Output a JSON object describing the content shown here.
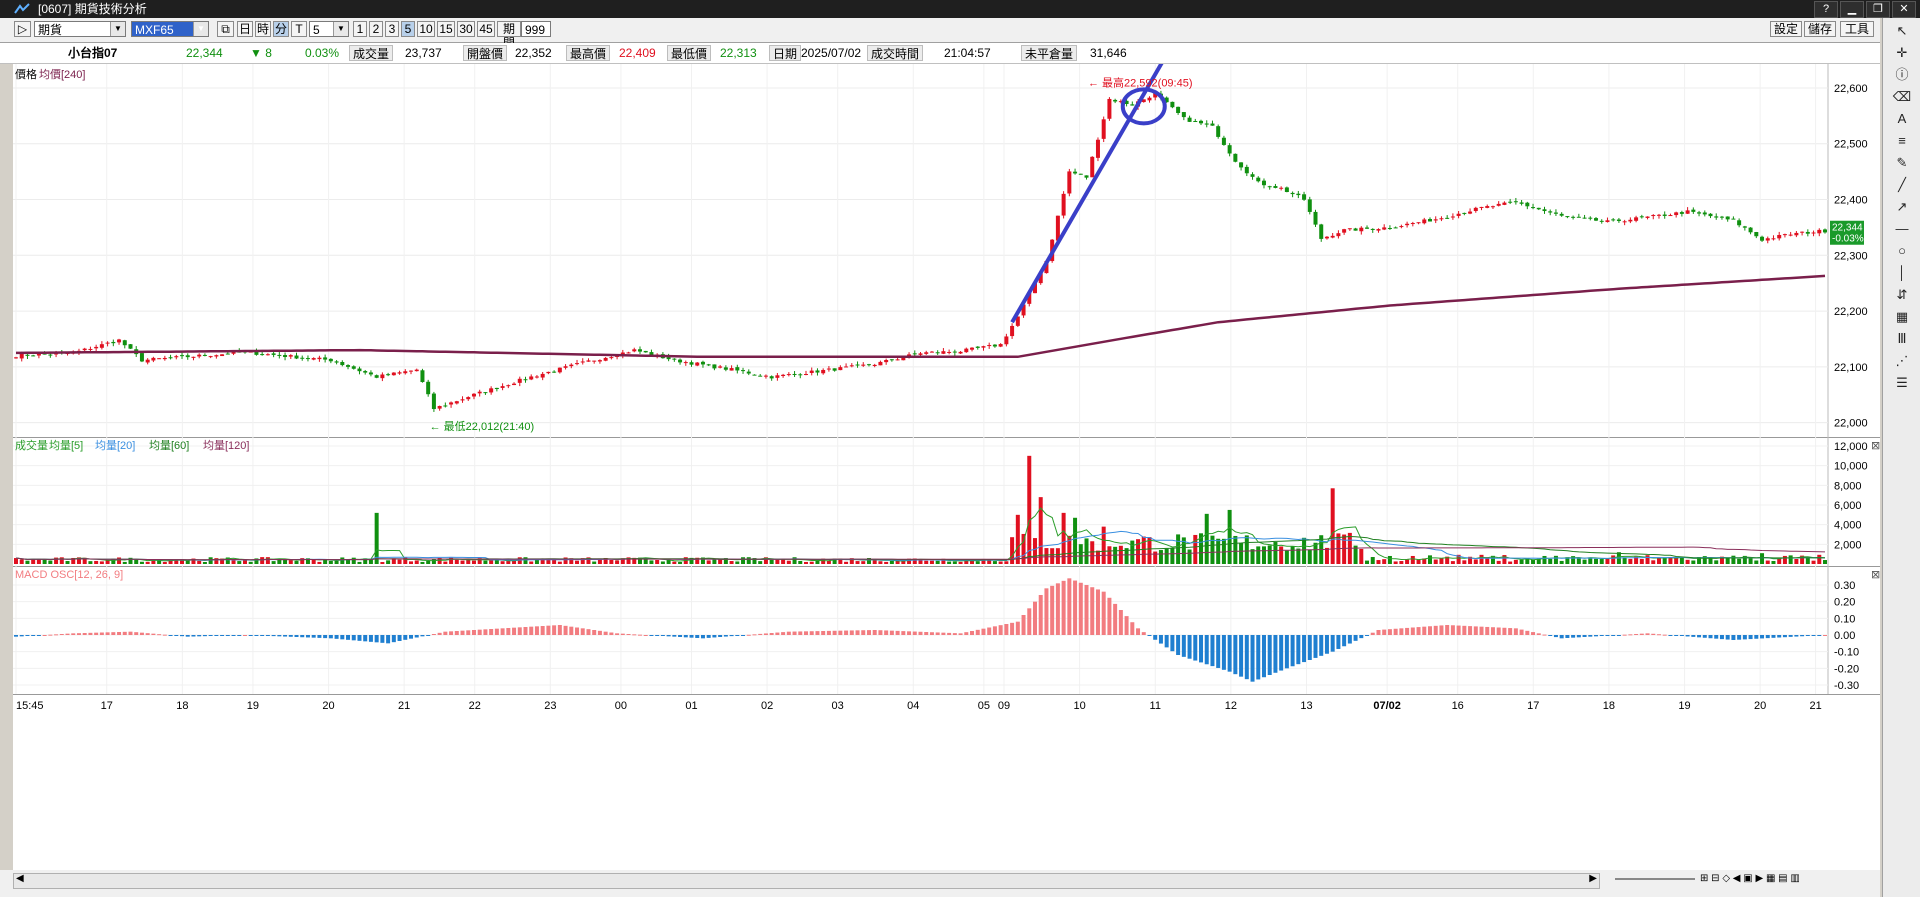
{
  "window": {
    "title": "[0607] 期貨技術分析"
  },
  "toolbar": {
    "market": "期貨",
    "symbol": "MXF65",
    "period_buttons": [
      "日",
      "時",
      "分",
      "T"
    ],
    "interval_value": "5",
    "quick_buttons": [
      "1",
      "2",
      "3",
      "5",
      "10",
      "15",
      "30",
      "45"
    ],
    "range_label": "期間",
    "range_value": "999",
    "right_buttons": [
      "設定",
      "儲存",
      "工具"
    ]
  },
  "quote": {
    "name": "小台指07",
    "last": "22,344",
    "change": "▼ 8",
    "change_pct": "0.03%",
    "volume_label": "成交量",
    "volume": "23,737",
    "open_label": "開盤價",
    "open": "22,352",
    "high_label": "最高價",
    "high": "22,409",
    "low_label": "最低價",
    "low": "22,313",
    "date_label": "日期",
    "date": "2025/07/02",
    "time_label": "成交時間",
    "time": "21:04:57",
    "oi_label": "未平倉量",
    "oi": "31,646"
  },
  "colors": {
    "up": "#e01020",
    "down": "#109010",
    "ma240": "#7a1f4b",
    "macd": "#f27c80",
    "macd_neg": "#1f7fd0",
    "trendline": "#3a3fc8",
    "vol_ma5": "#2a9d2a",
    "vol_ma20": "#3a8fe0",
    "vol_ma60": "#208020",
    "vol_ma120": "#8a2f5b"
  },
  "chart_data": [
    {
      "type": "candlestick",
      "panel": "price",
      "legend": [
        "價格",
        "均價[240]"
      ],
      "y_ticks": [
        "22,600",
        "22,500",
        "22,400",
        "22,300",
        "22,200",
        "22,100",
        "22,000"
      ],
      "ylim": [
        21985,
        22625
      ],
      "x_labels": [
        "15:45",
        "17",
        "18",
        "19",
        "20",
        "21",
        "22",
        "23",
        "00",
        "01",
        "02",
        "03",
        "04",
        "05",
        "09",
        "10",
        "11",
        "12",
        "13",
        "07/02",
        "16",
        "17",
        "18",
        "19",
        "20",
        "21"
      ],
      "annotations": {
        "high": "最高22,592(09:45)",
        "low": "最低22,012(21:40)",
        "last_price": "22,344",
        "last_pct": "-0.03%"
      },
      "keypoints": [
        [
          0,
          22120
        ],
        [
          10,
          22125
        ],
        [
          18,
          22148
        ],
        [
          22,
          22112
        ],
        [
          40,
          22126
        ],
        [
          55,
          22112
        ],
        [
          63,
          22082
        ],
        [
          70,
          22095
        ],
        [
          73,
          22025
        ],
        [
          80,
          22050
        ],
        [
          90,
          22082
        ],
        [
          100,
          22110
        ],
        [
          108,
          22130
        ],
        [
          115,
          22112
        ],
        [
          125,
          22095
        ],
        [
          132,
          22082
        ],
        [
          140,
          22092
        ],
        [
          150,
          22105
        ],
        [
          158,
          22125
        ],
        [
          165,
          22128
        ],
        [
          172,
          22140
        ],
        [
          175,
          22190
        ],
        [
          180,
          22290
        ],
        [
          184,
          22450
        ],
        [
          187,
          22440
        ],
        [
          191,
          22580
        ],
        [
          195,
          22570
        ],
        [
          199,
          22590
        ],
        [
          204,
          22545
        ],
        [
          209,
          22530
        ],
        [
          213,
          22470
        ],
        [
          217,
          22430
        ],
        [
          221,
          22420
        ],
        [
          225,
          22400
        ],
        [
          228,
          22330
        ],
        [
          232,
          22345
        ],
        [
          240,
          22350
        ],
        [
          248,
          22365
        ],
        [
          256,
          22385
        ],
        [
          262,
          22395
        ],
        [
          270,
          22370
        ],
        [
          278,
          22360
        ],
        [
          285,
          22368
        ],
        [
          292,
          22378
        ],
        [
          300,
          22362
        ],
        [
          305,
          22328
        ],
        [
          310,
          22338
        ],
        [
          316,
          22344
        ]
      ],
      "ma240_points": [
        [
          0,
          22125
        ],
        [
          60,
          22130
        ],
        [
          120,
          22118
        ],
        [
          175,
          22118
        ],
        [
          190,
          22145
        ],
        [
          210,
          22180
        ],
        [
          240,
          22210
        ],
        [
          280,
          22240
        ],
        [
          316,
          22263
        ]
      ]
    },
    {
      "type": "bar",
      "panel": "volume",
      "legend": [
        "成交量",
        "均量[5]",
        "均量[20]",
        "均量[60]",
        "均量[120]"
      ],
      "y_ticks": [
        "12,000",
        "10,000",
        "8,000",
        "6,000",
        "4,000",
        "2,000"
      ],
      "ylim": [
        0,
        12000
      ],
      "peaks": [
        [
          63,
          5200
        ],
        [
          175,
          5000
        ],
        [
          177,
          11000
        ],
        [
          179,
          6800
        ],
        [
          183,
          5200
        ],
        [
          185,
          4700
        ],
        [
          190,
          3800
        ],
        [
          208,
          5100
        ],
        [
          212,
          5500
        ],
        [
          230,
          7700
        ],
        [
          280,
          1200
        ],
        [
          305,
          1100
        ]
      ]
    },
    {
      "type": "bar",
      "panel": "macd",
      "legend": [
        "MACD OSC[12, 26, 9]"
      ],
      "y_ticks": [
        "0.30",
        "0.20",
        "0.10",
        "0.00",
        "-0.10",
        "-0.20",
        "-0.30"
      ],
      "ylim": [
        -0.33,
        0.36
      ],
      "keypoints": [
        [
          0,
          -0.01
        ],
        [
          10,
          0.01
        ],
        [
          20,
          0.02
        ],
        [
          30,
          -0.01
        ],
        [
          40,
          0.0
        ],
        [
          55,
          -0.02
        ],
        [
          65,
          -0.05
        ],
        [
          75,
          0.02
        ],
        [
          85,
          0.04
        ],
        [
          95,
          0.06
        ],
        [
          105,
          0.01
        ],
        [
          120,
          -0.02
        ],
        [
          135,
          0.02
        ],
        [
          150,
          0.03
        ],
        [
          165,
          0.01
        ],
        [
          175,
          0.08
        ],
        [
          180,
          0.28
        ],
        [
          184,
          0.34
        ],
        [
          190,
          0.26
        ],
        [
          196,
          0.04
        ],
        [
          203,
          -0.12
        ],
        [
          212,
          -0.22
        ],
        [
          216,
          -0.28
        ],
        [
          222,
          -0.2
        ],
        [
          230,
          -0.1
        ],
        [
          238,
          0.03
        ],
        [
          250,
          0.06
        ],
        [
          262,
          0.04
        ],
        [
          270,
          -0.02
        ],
        [
          285,
          0.01
        ],
        [
          300,
          -0.03
        ],
        [
          316,
          0.0
        ]
      ]
    }
  ]
}
